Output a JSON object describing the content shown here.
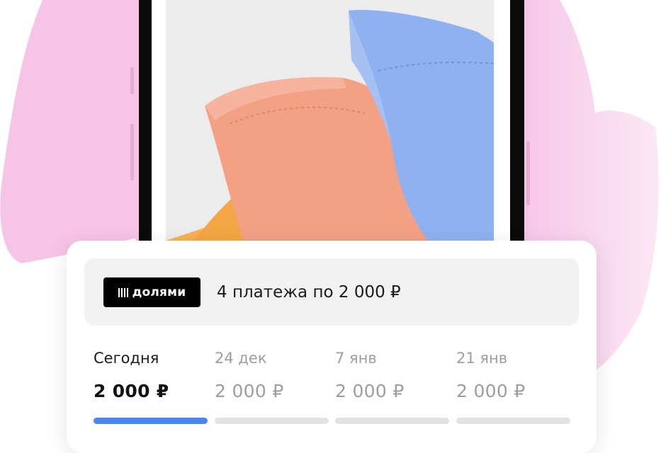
{
  "colors": {
    "accent_blue": "#4a86ee",
    "inactive_bar": "#e2e2e2",
    "blob_pink": "#f6c4e6",
    "badge_black": "#000000"
  },
  "banner": {
    "logo_icon": "four-bars-icon",
    "badge_label": "долями",
    "text": "4 платежа по 2 000 ₽"
  },
  "schedule": [
    {
      "date": "Сегодня",
      "amount": "2 000 ₽",
      "status": "paid",
      "progress": 1
    },
    {
      "date": "24 дек",
      "amount": "2 000 ₽",
      "status": "upcoming",
      "progress": 0
    },
    {
      "date": "7 янв",
      "amount": "2 000 ₽",
      "status": "upcoming",
      "progress": 0
    },
    {
      "date": "21 янв",
      "amount": "2 000 ₽",
      "status": "upcoming",
      "progress": 0
    }
  ]
}
